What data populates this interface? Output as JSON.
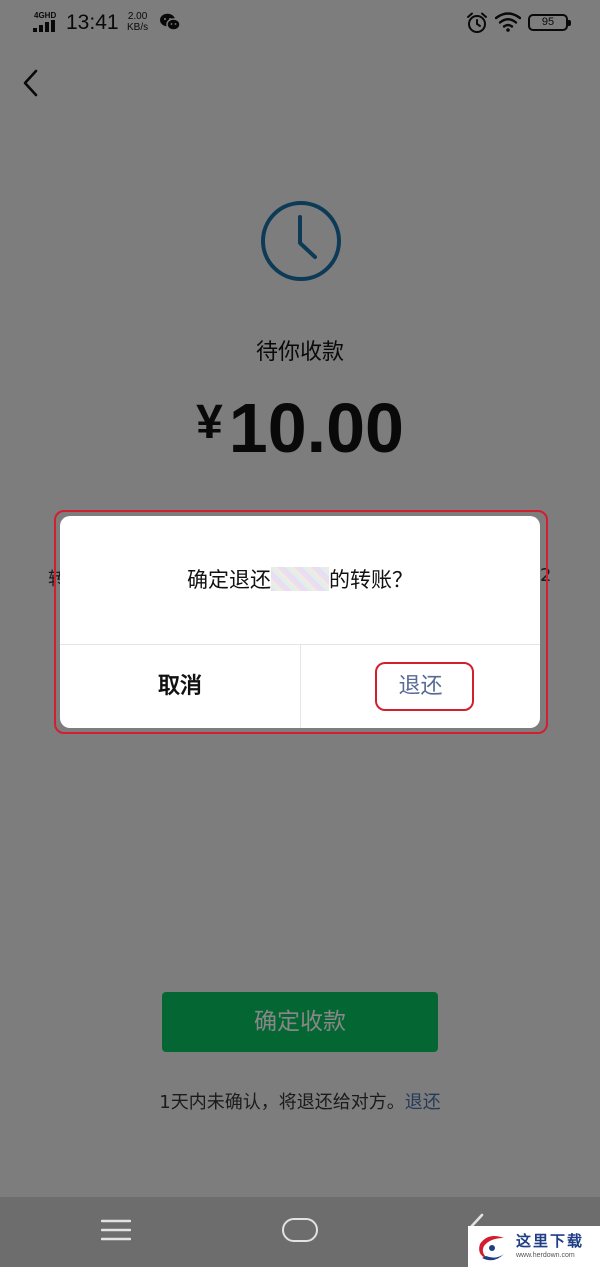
{
  "status_bar": {
    "network": "4GHD",
    "time": "13:41",
    "speed_value": "2.00",
    "speed_unit": "KB/s",
    "battery": "95",
    "icons": [
      "signal-icon",
      "wechat-icon",
      "alarm-icon",
      "wifi-icon",
      "battery-icon"
    ]
  },
  "nav": {
    "back_icon": "chevron-left-icon"
  },
  "transfer": {
    "status_icon": "clock-icon",
    "status_text": "待你收款",
    "currency": "¥",
    "amount": "10.00",
    "info_left_fragment": "转",
    "info_right_fragment": "2",
    "confirm_button": "确定收款",
    "footer_prefix": "1天内未确认，将退还给对方。",
    "footer_link": "退还"
  },
  "dialog": {
    "message_prefix": "确定退还",
    "message_suffix": "的转账？",
    "cancel_label": "取消",
    "refund_label": "退还"
  },
  "system_nav": {
    "icons": [
      "menu-icon",
      "home-icon",
      "back-icon"
    ]
  },
  "watermark": {
    "text": "这里下载",
    "url": "www.herdown.com"
  },
  "colors": {
    "primary_green": "#07c160",
    "link_blue": "#576b95",
    "clock_blue": "#1a6fa5",
    "highlight_red": "#d21f2f"
  }
}
